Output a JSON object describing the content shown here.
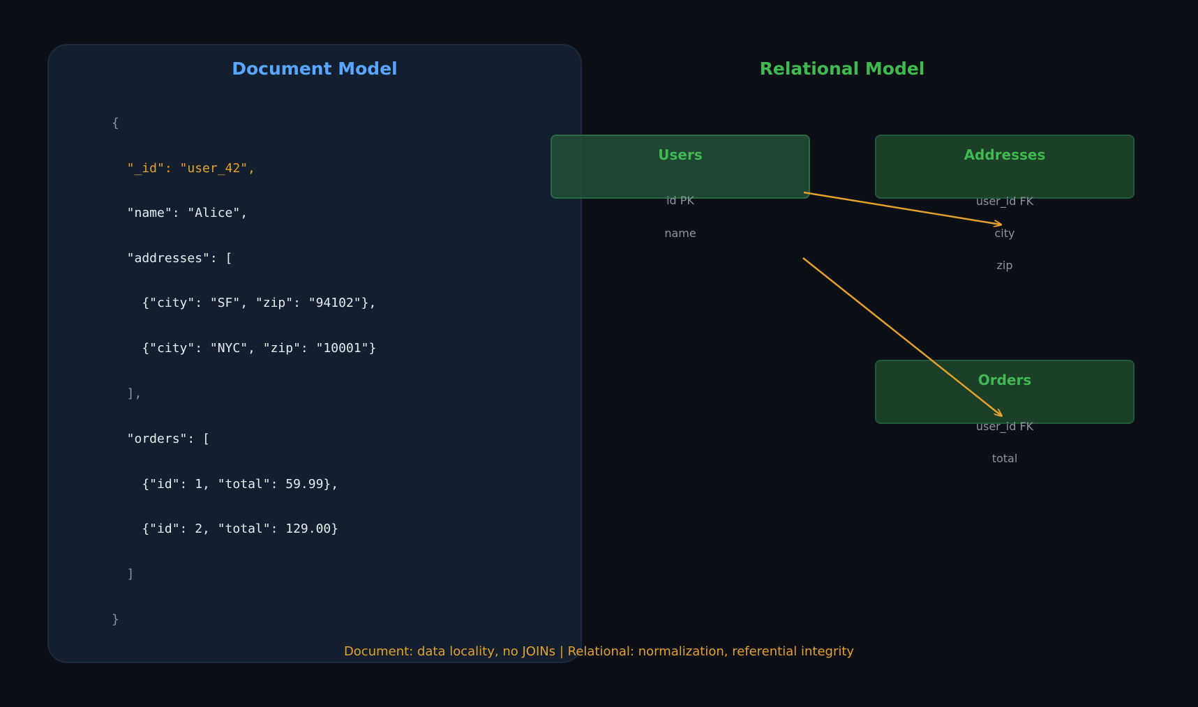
{
  "document_model": {
    "title": "Document Model",
    "lines": [
      "{",
      "  \"_id\": \"user_42\",",
      "  \"name\": \"Alice\",",
      "  \"addresses\": [",
      "    {\"city\": \"SF\", \"zip\": \"94102\"},",
      "    {\"city\": \"NYC\", \"zip\": \"10001\"}",
      "  ],",
      "  \"orders\": [",
      "    {\"id\": 1, \"total\": 59.99},",
      "    {\"id\": 2, \"total\": 129.00}",
      "  ]",
      "}"
    ]
  },
  "relational_model": {
    "title": "Relational Model",
    "tables": {
      "users": {
        "name": "Users",
        "fields": [
          "id PK",
          "name"
        ]
      },
      "addresses": {
        "name": "Addresses",
        "fields": [
          "user_id FK",
          "city",
          "zip"
        ]
      },
      "orders": {
        "name": "Orders",
        "fields": [
          "user_id FK",
          "total"
        ]
      }
    }
  },
  "footer": "Document: data locality, no JOINs | Relational: normalization, referential integrity",
  "colors": {
    "background": "#0c0f16",
    "document_accent": "#58a6ff",
    "relational_accent": "#3fb950",
    "arrow": "#e3a22d"
  }
}
